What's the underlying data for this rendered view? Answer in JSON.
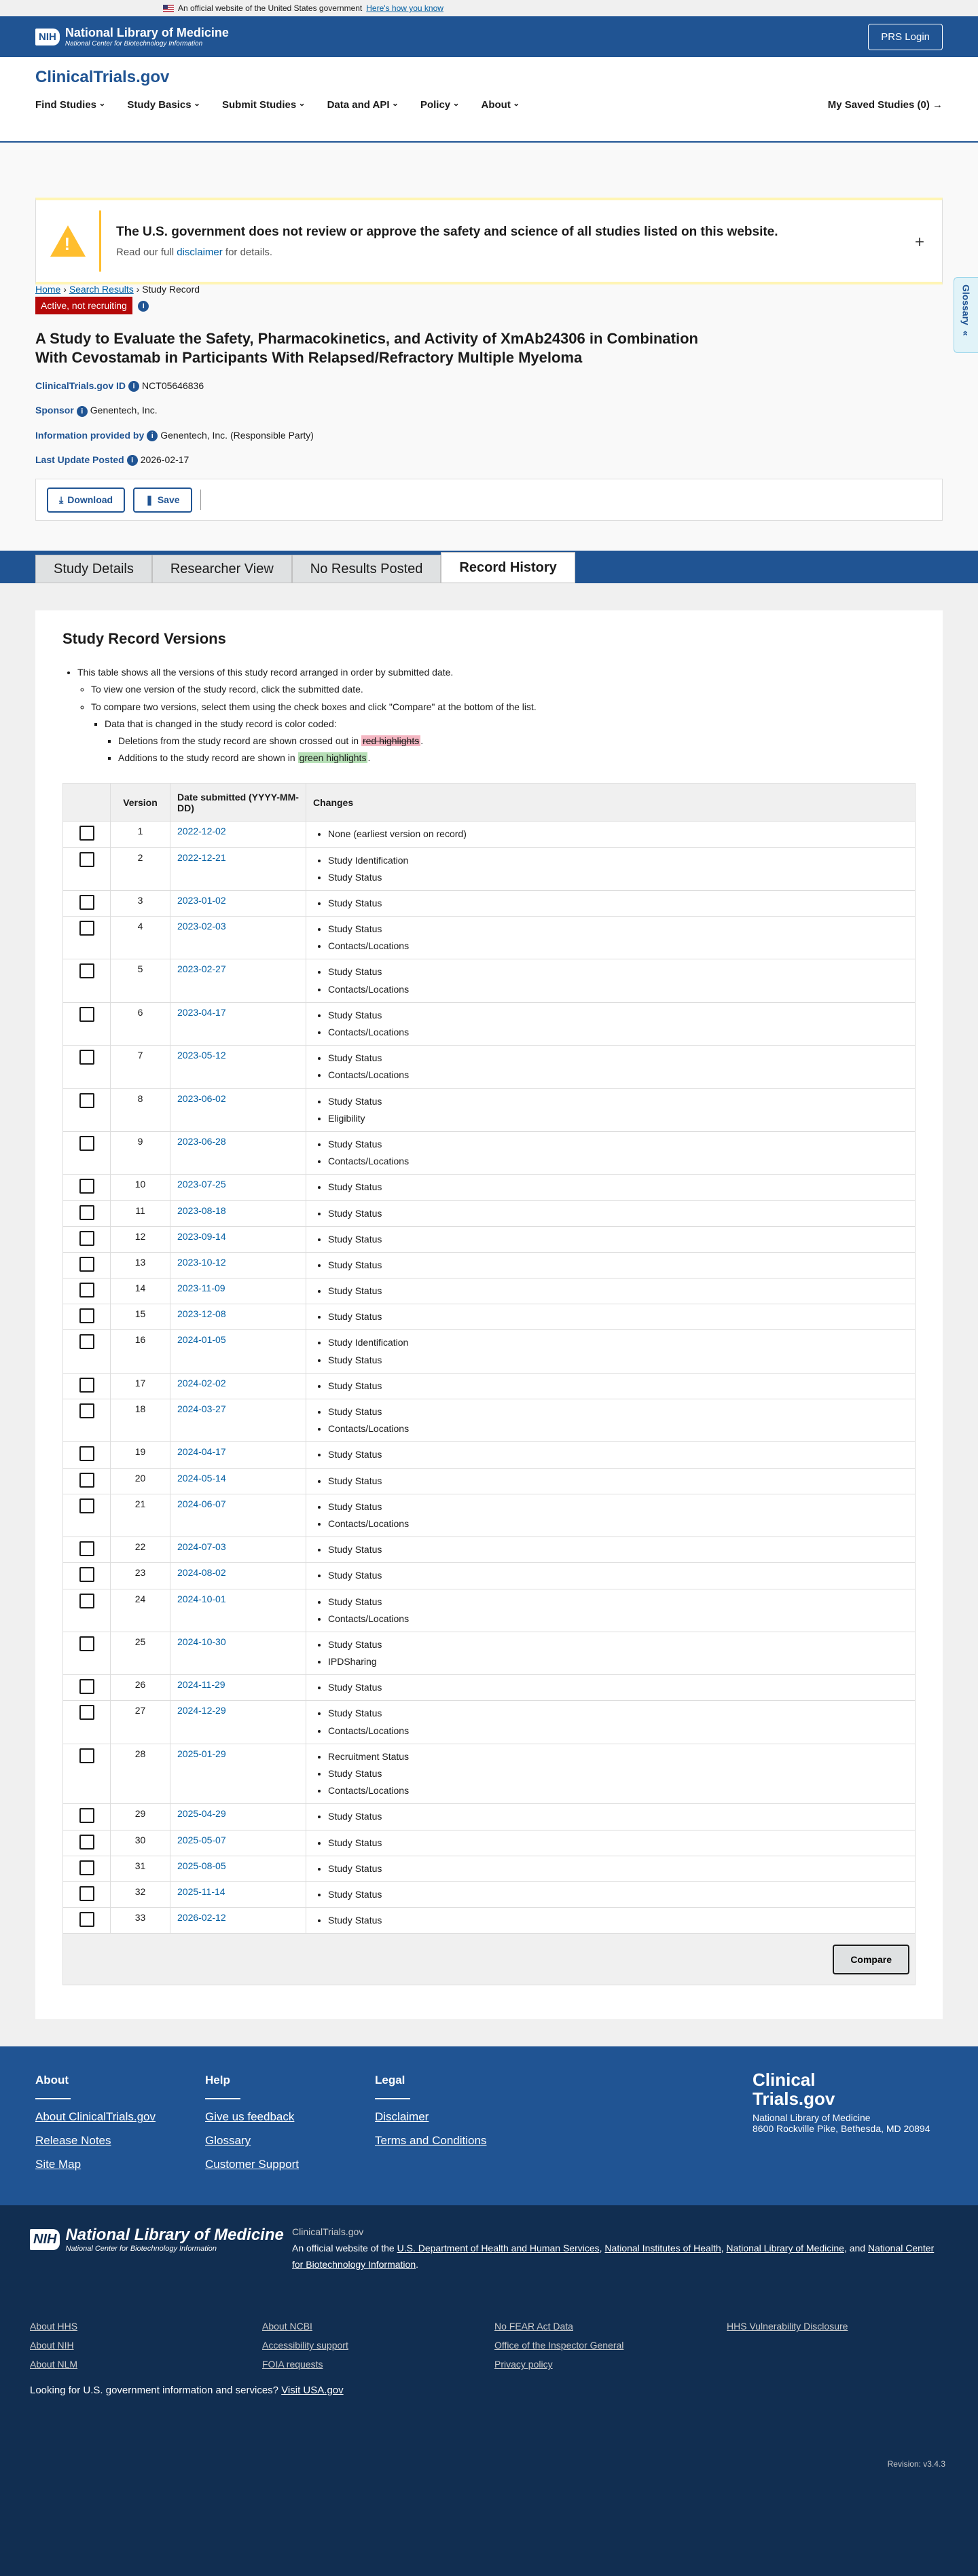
{
  "gov_banner": {
    "text": "An official website of the United States government",
    "link": "Here's how you know"
  },
  "nlm": {
    "badge": "NIH",
    "title": "National Library of Medicine",
    "subtitle": "National Center for Biotechnology Information",
    "prs_login": "PRS Login"
  },
  "site": {
    "brand": "ClinicalTrials.gov"
  },
  "nav": {
    "items": [
      "Find Studies",
      "Study Basics",
      "Submit Studies",
      "Data and API",
      "Policy",
      "About"
    ],
    "saved": "My Saved Studies (0) →"
  },
  "breadcrumb": {
    "home": "Home",
    "results": "Search Results",
    "current": "Study Record"
  },
  "glossary": "Glossary",
  "disclaimer": {
    "heading": "The U.S. government does not review or approve the safety and science of all studies listed on this website.",
    "pre": "Read our full ",
    "link": "disclaimer",
    "post": " for details."
  },
  "study": {
    "status": "Active, not recruiting",
    "title": "A Study to Evaluate the Safety, Pharmacokinetics, and Activity of XmAb24306 in Combination With Cevostamab in Participants With Relapsed/Refractory Multiple Myeloma",
    "id_label": "ClinicalTrials.gov ID",
    "id": "NCT05646836",
    "sponsor_label": "Sponsor",
    "sponsor": "Genentech, Inc.",
    "info_label": "Information provided by",
    "info": "Genentech, Inc. (Responsible Party)",
    "update_label": "Last Update Posted",
    "update": "2026-02-17"
  },
  "actions": {
    "download": "Download",
    "save": "Save"
  },
  "tabs": [
    "Study Details",
    "Researcher View",
    "No Results Posted",
    "Record History"
  ],
  "versions": {
    "heading": "Study Record Versions",
    "b1": "This table shows all the versions of this study record arranged in order by submitted date.",
    "b2": "To view one version of the study record, click the submitted date.",
    "b3": "To compare two versions, select them using the check boxes and click \"Compare\" at the bottom of the list.",
    "b4": "Data that is changed in the study record is color coded:",
    "b5_pre": "Deletions from the study record are shown crossed out in ",
    "b5_hl": "red highlights",
    "b5_post": ".",
    "b6_pre": "Additions to the study record are shown in ",
    "b6_hl": "green highlights",
    "b6_post": ".",
    "col_version": "Version",
    "col_date": "Date submitted (YYYY-MM-DD)",
    "col_changes": "Changes",
    "compare": "Compare",
    "rows": [
      {
        "v": "1",
        "d": "2022-12-02",
        "c": [
          "None (earliest version on record)"
        ]
      },
      {
        "v": "2",
        "d": "2022-12-21",
        "c": [
          "Study Identification",
          "Study Status"
        ]
      },
      {
        "v": "3",
        "d": "2023-01-02",
        "c": [
          "Study Status"
        ]
      },
      {
        "v": "4",
        "d": "2023-02-03",
        "c": [
          "Study Status",
          "Contacts/Locations"
        ]
      },
      {
        "v": "5",
        "d": "2023-02-27",
        "c": [
          "Study Status",
          "Contacts/Locations"
        ]
      },
      {
        "v": "6",
        "d": "2023-04-17",
        "c": [
          "Study Status",
          "Contacts/Locations"
        ]
      },
      {
        "v": "7",
        "d": "2023-05-12",
        "c": [
          "Study Status",
          "Contacts/Locations"
        ]
      },
      {
        "v": "8",
        "d": "2023-06-02",
        "c": [
          "Study Status",
          "Eligibility"
        ]
      },
      {
        "v": "9",
        "d": "2023-06-28",
        "c": [
          "Study Status",
          "Contacts/Locations"
        ]
      },
      {
        "v": "10",
        "d": "2023-07-25",
        "c": [
          "Study Status"
        ]
      },
      {
        "v": "11",
        "d": "2023-08-18",
        "c": [
          "Study Status"
        ]
      },
      {
        "v": "12",
        "d": "2023-09-14",
        "c": [
          "Study Status"
        ]
      },
      {
        "v": "13",
        "d": "2023-10-12",
        "c": [
          "Study Status"
        ]
      },
      {
        "v": "14",
        "d": "2023-11-09",
        "c": [
          "Study Status"
        ]
      },
      {
        "v": "15",
        "d": "2023-12-08",
        "c": [
          "Study Status"
        ]
      },
      {
        "v": "16",
        "d": "2024-01-05",
        "c": [
          "Study Identification",
          "Study Status"
        ]
      },
      {
        "v": "17",
        "d": "2024-02-02",
        "c": [
          "Study Status"
        ]
      },
      {
        "v": "18",
        "d": "2024-03-27",
        "c": [
          "Study Status",
          "Contacts/Locations"
        ]
      },
      {
        "v": "19",
        "d": "2024-04-17",
        "c": [
          "Study Status"
        ]
      },
      {
        "v": "20",
        "d": "2024-05-14",
        "c": [
          "Study Status"
        ]
      },
      {
        "v": "21",
        "d": "2024-06-07",
        "c": [
          "Study Status",
          "Contacts/Locations"
        ]
      },
      {
        "v": "22",
        "d": "2024-07-03",
        "c": [
          "Study Status"
        ]
      },
      {
        "v": "23",
        "d": "2024-08-02",
        "c": [
          "Study Status"
        ]
      },
      {
        "v": "24",
        "d": "2024-10-01",
        "c": [
          "Study Status",
          "Contacts/Locations"
        ]
      },
      {
        "v": "25",
        "d": "2024-10-30",
        "c": [
          "Study Status",
          "IPDSharing"
        ]
      },
      {
        "v": "26",
        "d": "2024-11-29",
        "c": [
          "Study Status"
        ]
      },
      {
        "v": "27",
        "d": "2024-12-29",
        "c": [
          "Study Status",
          "Contacts/Locations"
        ]
      },
      {
        "v": "28",
        "d": "2025-01-29",
        "c": [
          "Recruitment Status",
          "Study Status",
          "Contacts/Locations"
        ]
      },
      {
        "v": "29",
        "d": "2025-04-29",
        "c": [
          "Study Status"
        ]
      },
      {
        "v": "30",
        "d": "2025-05-07",
        "c": [
          "Study Status"
        ]
      },
      {
        "v": "31",
        "d": "2025-08-05",
        "c": [
          "Study Status"
        ]
      },
      {
        "v": "32",
        "d": "2025-11-14",
        "c": [
          "Study Status"
        ]
      },
      {
        "v": "33",
        "d": "2026-02-12",
        "c": [
          "Study Status"
        ]
      }
    ]
  },
  "footer": {
    "about": {
      "title": "About",
      "links": [
        "About ClinicalTrials.gov",
        "Release Notes",
        "Site Map"
      ]
    },
    "help": {
      "title": "Help",
      "links": [
        "Give us feedback",
        "Glossary",
        "Customer Support"
      ]
    },
    "legal": {
      "title": "Legal",
      "links": [
        "Disclaimer",
        "Terms and Conditions"
      ]
    },
    "brand1": "Clinical",
    "brand2": "Trials.gov",
    "addr1": "National Library of Medicine",
    "addr2": "8600 Rockville Pike, Bethesda, MD 20894",
    "nlm_badge": "NIH",
    "nlm_title": "National Library of Medicine",
    "nlm_sub": "National Center for Biotechnology Information",
    "site": "ClinicalTrials.gov",
    "desc_pre": "An official website of the ",
    "hhs": "U.S. Department of Health and Human Services",
    "nih": "National Institutes of Health",
    "nlm": "National Library of Medicine",
    "ncbi": "National Center for Biotechnology Information",
    "links": [
      [
        "About HHS",
        "About NIH",
        "About NLM"
      ],
      [
        "About NCBI",
        "Accessibility support",
        "FOIA requests"
      ],
      [
        "No FEAR Act Data",
        "Office of the Inspector General",
        "Privacy policy"
      ],
      [
        "HHS Vulnerability Disclosure"
      ]
    ],
    "usa_pre": "Looking for U.S. government information and services?",
    "usa_link": "Visit USA.gov",
    "revision": "Revision: v3.4.3"
  }
}
